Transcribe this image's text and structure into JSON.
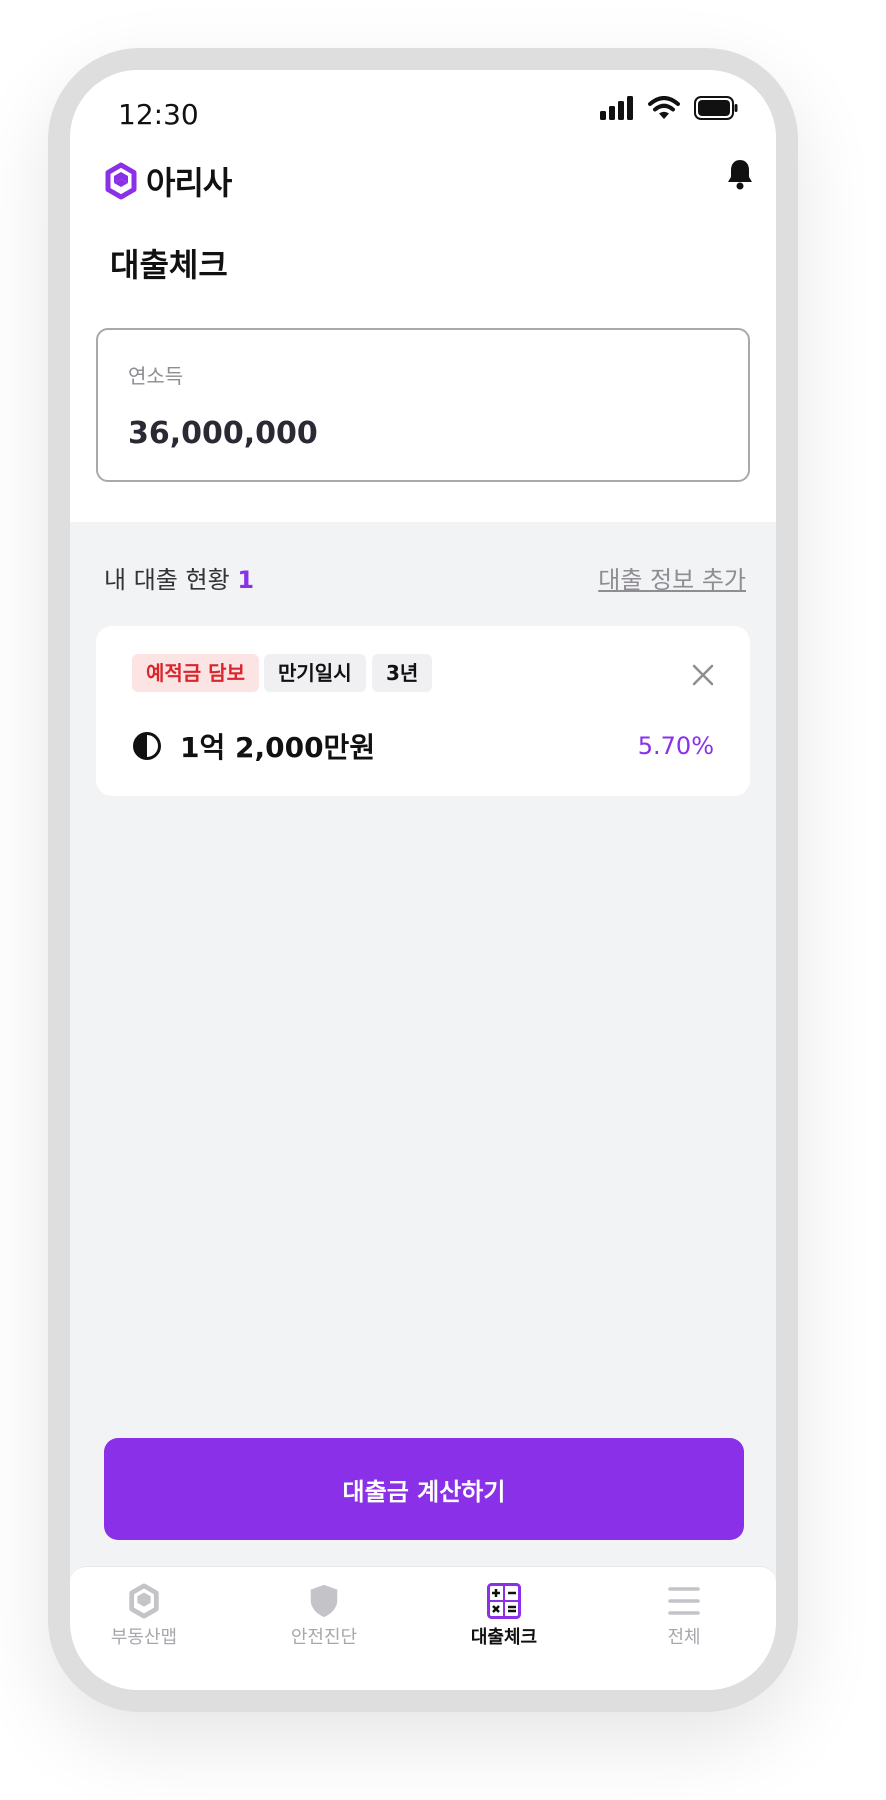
{
  "status_bar": {
    "time": "12:30"
  },
  "header": {
    "logo_text": "아리사"
  },
  "page": {
    "title": "대출체크"
  },
  "income": {
    "label": "연소득",
    "value": "36,000,000"
  },
  "loans": {
    "header_label": "내 대출 현황",
    "count": "1",
    "add_link": "대출 정보 추가",
    "items": [
      {
        "tags": [
          "예적금 담보",
          "만기일시",
          "3년"
        ],
        "amount": "1억 2,000만원",
        "rate": "5.70%"
      }
    ]
  },
  "cta": {
    "label": "대출금 계산하기"
  },
  "tabbar": {
    "tabs": [
      {
        "label": "부동산맵",
        "icon": "cube-icon",
        "active": false
      },
      {
        "label": "안전진단",
        "icon": "shield-icon",
        "active": false
      },
      {
        "label": "대출체크",
        "icon": "calculator-icon",
        "active": true
      },
      {
        "label": "전체",
        "icon": "menu-icon",
        "active": false
      }
    ]
  },
  "colors": {
    "accent": "#8a30e8",
    "tag_red_bg": "#fde4e4",
    "tag_red_text": "#d9262b"
  }
}
